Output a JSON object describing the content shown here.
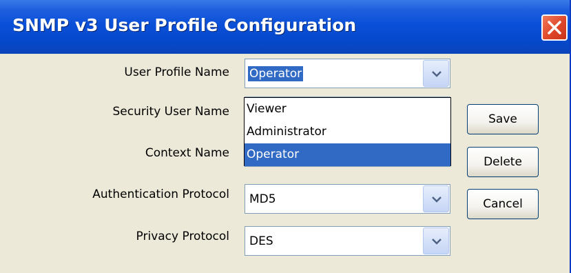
{
  "window": {
    "title": "SNMP v3 User Profile Configuration"
  },
  "form": {
    "user_profile_name_label": "User Profile Name",
    "user_profile_name_value": "Operator",
    "security_user_name_label": "Security User Name",
    "context_name_label": "Context Name",
    "authentication_protocol_label": "Authentication Protocol",
    "authentication_protocol_value": "MD5",
    "privacy_protocol_label": "Privacy Protocol",
    "privacy_protocol_value": "DES"
  },
  "dropdown": {
    "options": [
      "Viewer",
      "Administrator",
      "Operator"
    ],
    "highlighted": "Operator"
  },
  "buttons": {
    "save": "Save",
    "delete": "Delete",
    "cancel": "Cancel"
  },
  "colors": {
    "titlebar": "#0548cc",
    "selection": "#316ac5",
    "close": "#e0472a",
    "dialog_bg": "#ece9d8"
  },
  "icons": {
    "close": "close-icon",
    "dropdown_arrow": "chevron-down-icon"
  }
}
